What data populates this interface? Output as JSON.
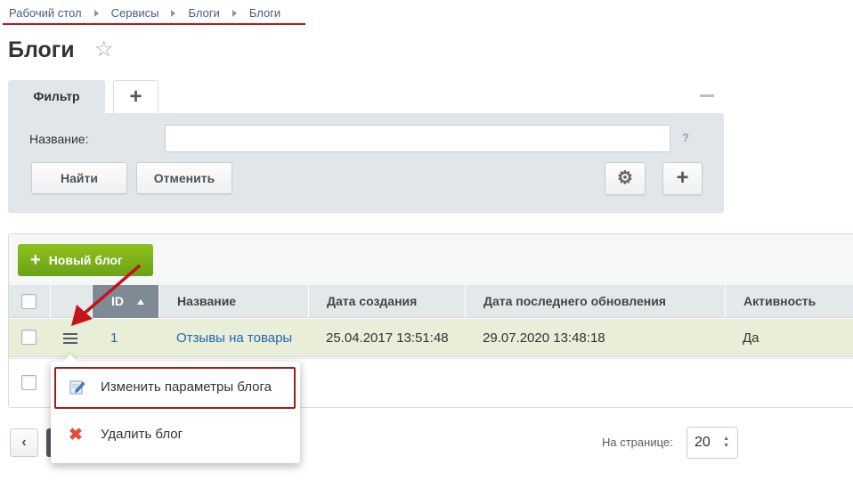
{
  "breadcrumb": [
    "Рабочий стол",
    "Сервисы",
    "Блоги",
    "Блоги"
  ],
  "page": {
    "title": "Блоги"
  },
  "filter": {
    "tab_label": "Фильтр",
    "add_tab": "+",
    "field_label": "Название:",
    "field_value": "",
    "help": "?",
    "find_label": "Найти",
    "cancel_label": "Отменить",
    "plus": "+"
  },
  "toolbar": {
    "new_label": "Новый блог"
  },
  "table": {
    "columns": [
      "ID",
      "Название",
      "Дата создания",
      "Дата последнего обновления",
      "Активность"
    ],
    "sorted_column": "ID",
    "sort_direction": "asc",
    "rows": [
      {
        "id": "1",
        "name": "Отзывы на товары",
        "created": "25.04.2017 13:51:48",
        "updated": "29.07.2020 13:48:18",
        "active": "Да"
      }
    ]
  },
  "context_menu": {
    "items": [
      "Изменить параметры блога",
      "Удалить блог"
    ]
  },
  "pagination": {
    "per_page_label": "На странице:",
    "per_page_value": "20"
  },
  "colors": {
    "accent_green": "#7ab31a",
    "highlight_red": "#a31c1c",
    "link_blue": "#2067b0"
  }
}
